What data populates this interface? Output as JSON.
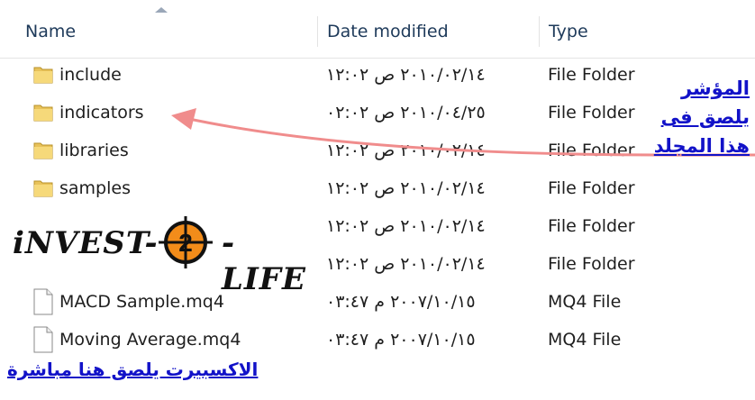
{
  "columns": {
    "name": "Name",
    "date": "Date modified",
    "type": "Type"
  },
  "rows": [
    {
      "kind": "folder",
      "name": "include",
      "date": "٢٠١٠/٠٢/١٤ ص ١٢:٠٢",
      "type": "File Folder"
    },
    {
      "kind": "folder",
      "name": "indicators",
      "date": "٢٠١٠/٠٤/٢٥ ص ٠٢:٠٢",
      "type": "File Folder"
    },
    {
      "kind": "folder",
      "name": "libraries",
      "date": "٢٠١٠/٠٢/١٤ ص ١٢:٠٢",
      "type": "File Folder"
    },
    {
      "kind": "folder",
      "name": "samples",
      "date": "٢٠١٠/٠٢/١٤ ص ١٢:٠٢",
      "type": "File Folder"
    },
    {
      "kind": "folder",
      "name": "",
      "date": "٢٠١٠/٠٢/١٤ ص ١٢:٠٢",
      "type": "File Folder"
    },
    {
      "kind": "folder",
      "name": "",
      "date": "٢٠١٠/٠٢/١٤ ص ١٢:٠٢",
      "type": "File Folder"
    },
    {
      "kind": "file",
      "name": "MACD Sample.mq4",
      "date": "٢٠٠٧/١٠/١٥ م ٠٣:٤٧",
      "type": "MQ4 File"
    },
    {
      "kind": "file",
      "name": "Moving Average.mq4",
      "date": "٢٠٠٧/١٠/١٥ م ٠٣:٤٧",
      "type": "MQ4 File"
    }
  ],
  "logo": {
    "left": "iNVEST-",
    "right": "-LIFE"
  },
  "annotations": {
    "right_lines": [
      "المؤشر",
      "يلصق فى",
      "هذا المجلد"
    ],
    "bottom": "الاكسبيرت يلصق هنا مباشرة"
  },
  "colors": {
    "annotation_text": "#1212c8",
    "arrow": "#f08c8c",
    "folder": "#e8c25a"
  }
}
